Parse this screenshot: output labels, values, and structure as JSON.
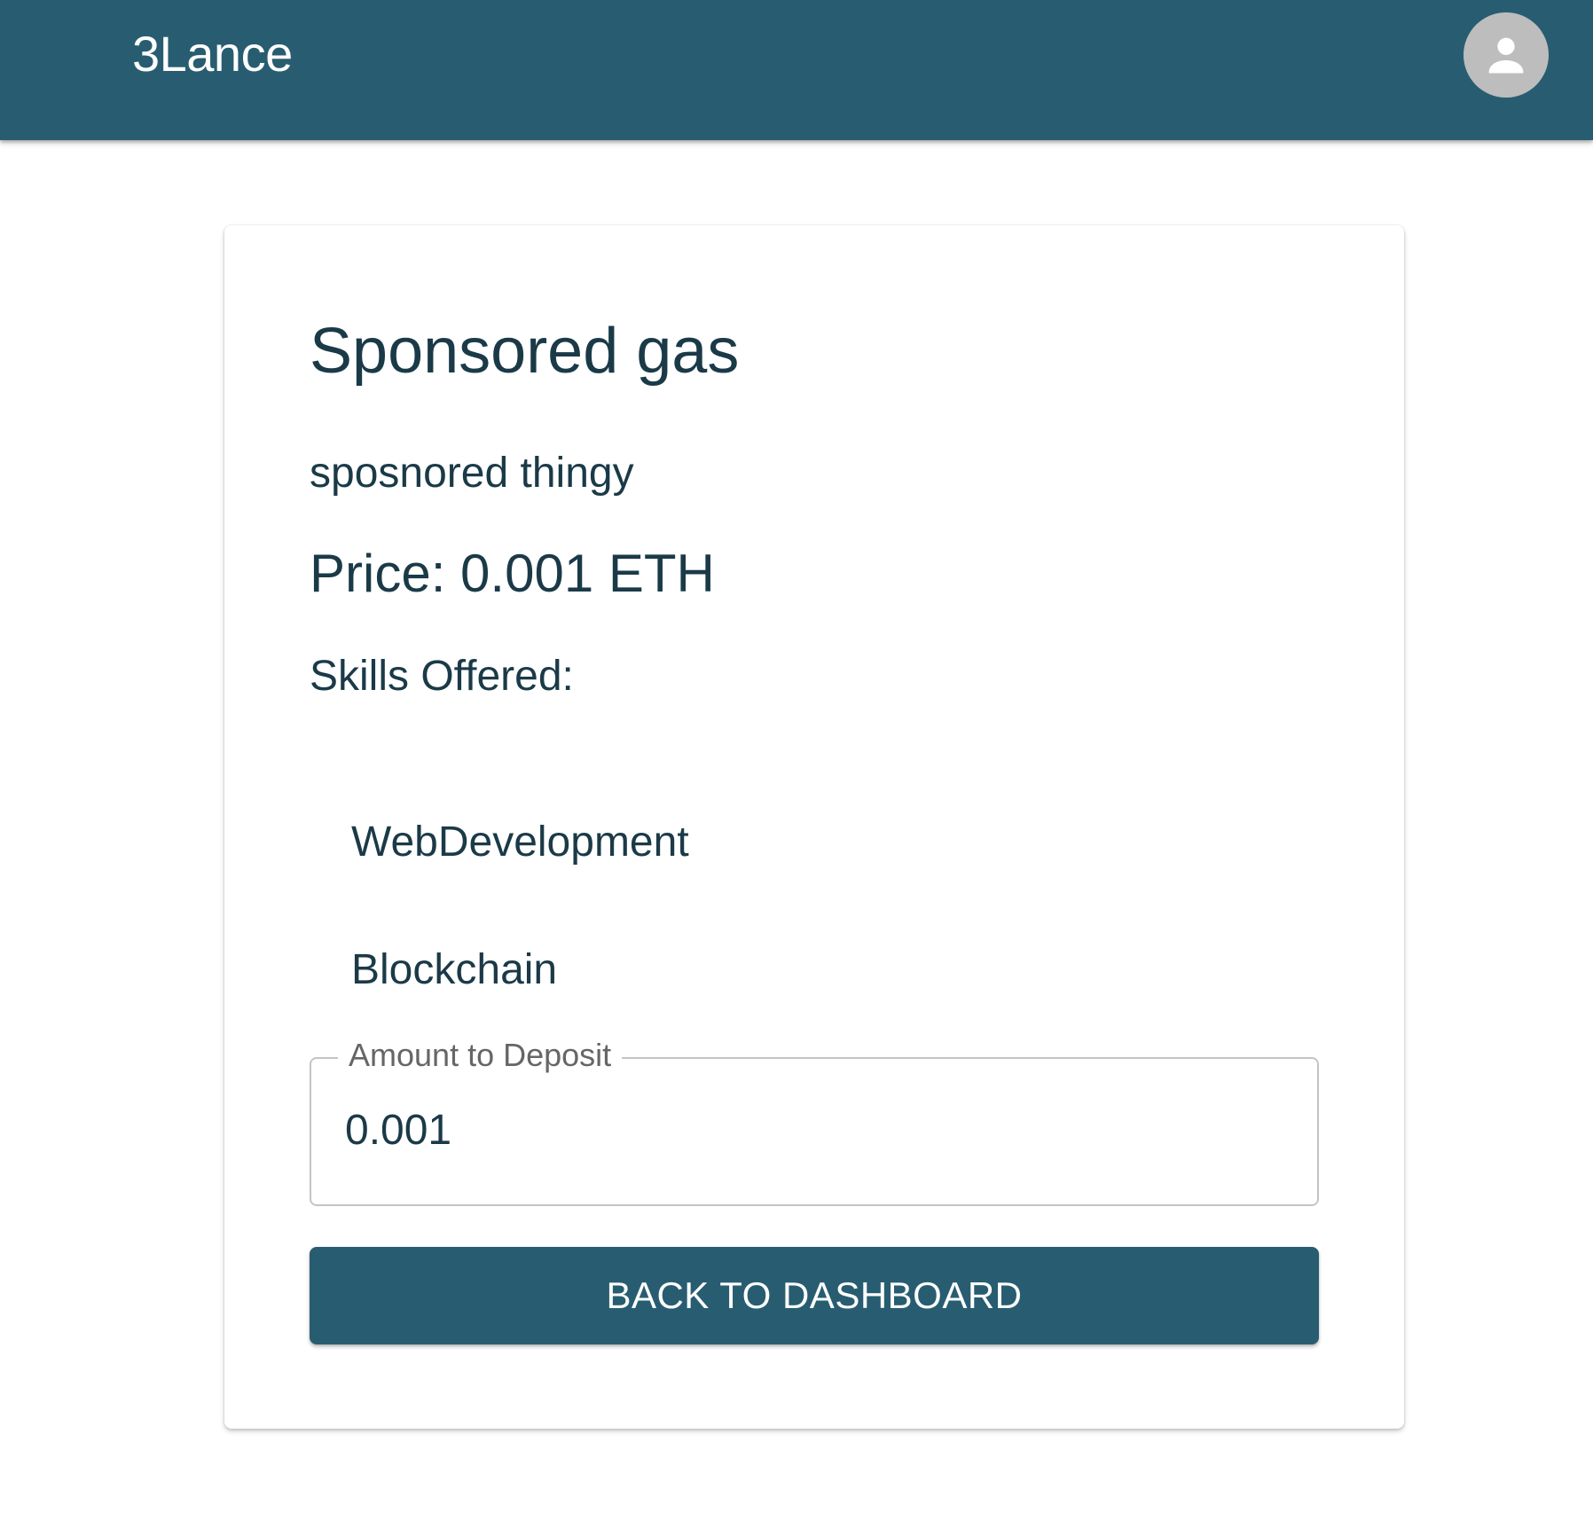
{
  "app": {
    "brand": "3Lance",
    "colors": {
      "primary": "#285d71",
      "text": "#1b3a48",
      "avatar_bg": "#bdbdbd"
    },
    "avatar_icon": "person-icon"
  },
  "listing": {
    "title": "Sponsored gas",
    "description": "sposnored thingy",
    "price": "Price: 0.001 ETH",
    "skills_heading": "Skills Offered:",
    "skills": [
      "WebDevelopment",
      "Blockchain"
    ]
  },
  "deposit": {
    "label": "Amount to Deposit",
    "value": "0.001"
  },
  "actions": {
    "back_label": "BACK TO DASHBOARD"
  }
}
